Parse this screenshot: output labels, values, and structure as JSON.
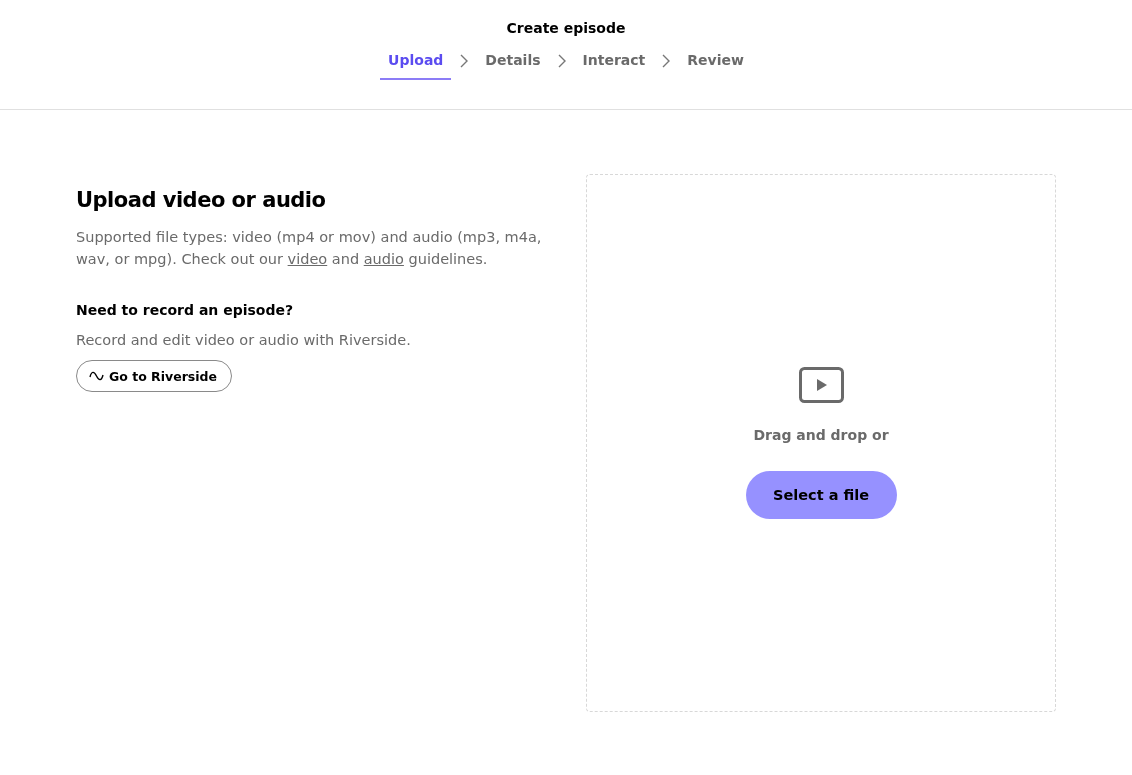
{
  "header": {
    "title": "Create episode"
  },
  "steps": [
    {
      "label": "Upload",
      "selected": true
    },
    {
      "label": "Details",
      "selected": false
    },
    {
      "label": "Interact",
      "selected": false
    },
    {
      "label": "Review",
      "selected": false
    }
  ],
  "upload": {
    "heading": "Upload video or audio",
    "description": [
      {
        "kind": "text",
        "text": "Supported file types: video (mp4 or mov) and audio (mp3, m4a, wav, or mpg). Check out our "
      },
      {
        "kind": "link",
        "text": "video"
      },
      {
        "kind": "text",
        "text": " and "
      },
      {
        "kind": "link",
        "text": "audio"
      },
      {
        "kind": "text",
        "text": " guidelines."
      }
    ],
    "record_heading": "Need to record an episode?",
    "record_text": "Record and edit video or audio with Riverside.",
    "record_button": "Go to Riverside"
  },
  "dropzone": {
    "prompt": "Drag and drop or",
    "button": "Select a file"
  }
}
